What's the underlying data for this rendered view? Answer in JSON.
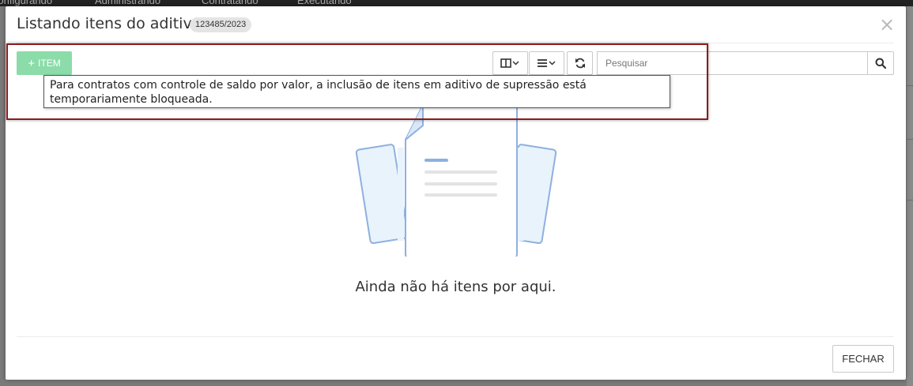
{
  "background": {
    "nav_items": [
      "Configurando",
      "Administrando",
      "Contratando",
      "Executando"
    ]
  },
  "modal": {
    "title": "Listando itens do aditivo",
    "badge": "123485/2023",
    "close_glyph": "×"
  },
  "toolbar": {
    "add_item_label": "ITEM",
    "add_item_icon": "plus-icon",
    "columns_icon": "columns-icon",
    "list_icon": "list-icon",
    "refresh_icon": "refresh-icon",
    "search_placeholder": "Pesquisar",
    "search_value": "",
    "search_icon": "search-icon"
  },
  "tooltip": {
    "text": "Para contratos com controle de saldo por valor, a inclusão de itens em aditivo de supressão está temporariamente bloqueada."
  },
  "empty_state": {
    "message": "Ainda não há itens por aqui.",
    "illustration": "documents-illustration"
  },
  "footer": {
    "close_label": "FECHAR"
  },
  "colors": {
    "add_button": "#8bdca9",
    "highlight_border": "#8a1c1c",
    "illustration_stroke": "#8fb0e0",
    "illustration_fill": "#e8f3fb"
  }
}
